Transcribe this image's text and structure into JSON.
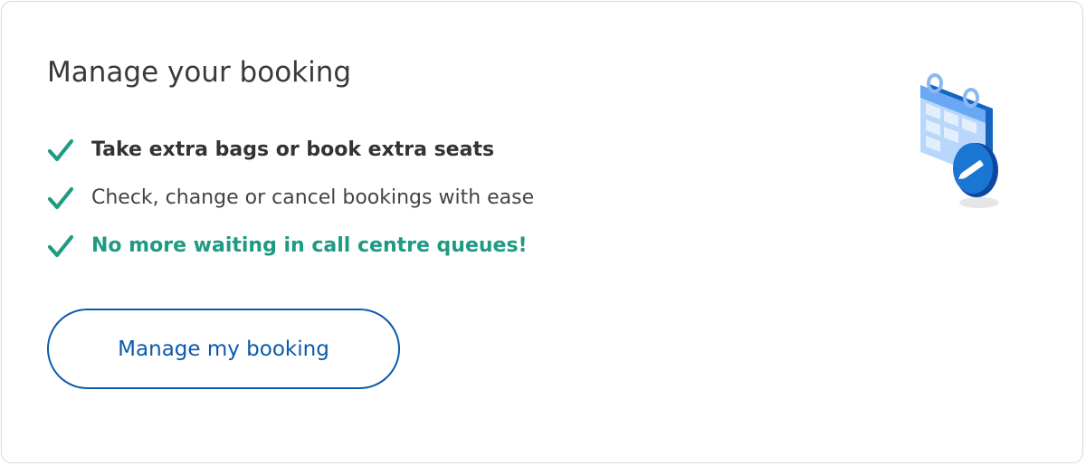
{
  "card": {
    "title": "Manage your booking",
    "features": [
      {
        "text": "Take extra bags or book extra seats",
        "icon": "check-icon"
      },
      {
        "text": "Check, change or cancel bookings with ease",
        "icon": "check-icon"
      },
      {
        "text": "No more waiting in call centre queues!",
        "icon": "check-icon"
      }
    ],
    "cta_label": "Manage my booking",
    "illustration_icon": "calendar-edit-icon"
  },
  "colors": {
    "check_green": "#1f9a82",
    "button_blue": "#0a5bab",
    "title_text": "#3a3a3a",
    "border": "#d9d9d9"
  }
}
